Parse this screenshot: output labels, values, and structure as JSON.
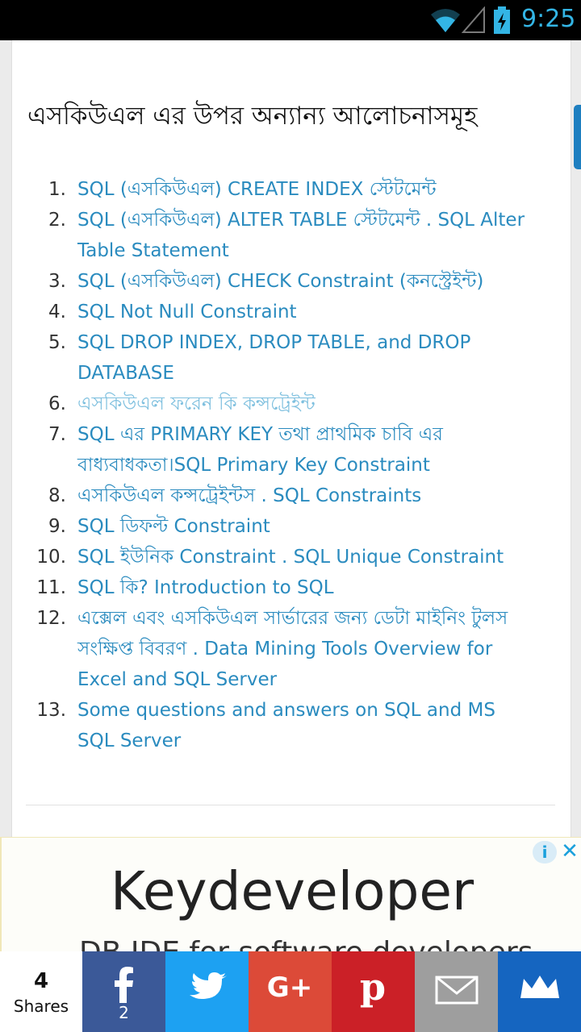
{
  "status_bar": {
    "time": "9:25",
    "icons": [
      "wifi-icon",
      "signal-icon",
      "battery-charging-icon"
    ]
  },
  "heading": "এসকিউএল এর উপর অন্যান্য আলোচনাসমূহ",
  "related": [
    {
      "num": "1.",
      "text": "SQL (এসকিউএল) CREATE INDEX স্টেটমেন্ট"
    },
    {
      "num": "2.",
      "text": "SQL (এসকিউএল) ALTER TABLE স্টেটমেন্ট . SQL Alter Table Statement"
    },
    {
      "num": "3.",
      "text": "SQL (এসকিউএল) CHECK Constraint (কনস্ট্রেইন্ট)"
    },
    {
      "num": "4.",
      "text": "SQL Not Null Constraint"
    },
    {
      "num": "5.",
      "text": "SQL DROP INDEX, DROP TABLE, and DROP DATABASE"
    },
    {
      "num": "6.",
      "text": "এসকিউএল ফরেন কি কন্সট্রেইন্ট"
    },
    {
      "num": "7.",
      "text": "SQL এর PRIMARY KEY তথা প্রাথমিক চাবি এর বাধ্যবাধকতা।SQL Primary Key Constraint"
    },
    {
      "num": "8.",
      "text": "এসকিউএল কন্সট্রেইন্টস . SQL Constraints"
    },
    {
      "num": "9.",
      "text": "SQL ডিফল্ট Constraint"
    },
    {
      "num": "10.",
      "text": "SQL ইউনিক Constraint . SQL Unique Constraint"
    },
    {
      "num": "11.",
      "text": "SQL কি? Introduction to SQL"
    },
    {
      "num": "12.",
      "text": "এক্সেল এবং এসকিউএল সার্ভারের জন্য ডেটা মাইনিং টুলস সংক্ষিপ্ত বিবরণ . Data Mining Tools Overview for Excel and SQL Server"
    },
    {
      "num": "13.",
      "text": "Some questions and answers on SQL and MS SQL Server"
    }
  ],
  "ad": {
    "title": "Keydeveloper",
    "subtitle": "DB IDE for software developers"
  },
  "share": {
    "count": "4",
    "count_label": "Shares",
    "facebook_count": "2",
    "buttons": [
      "facebook-icon",
      "twitter-icon",
      "google-plus-icon",
      "pinterest-icon",
      "email-icon",
      "sumome-crown-icon"
    ]
  },
  "colors": {
    "link": "#2a8bbf",
    "visited_link": "#7fc0df",
    "facebook": "#3b5998",
    "twitter": "#1da1f2",
    "google_plus": "#dc4a38",
    "pinterest": "#cb2027",
    "email": "#9e9e9e",
    "sumome": "#1565c0"
  }
}
